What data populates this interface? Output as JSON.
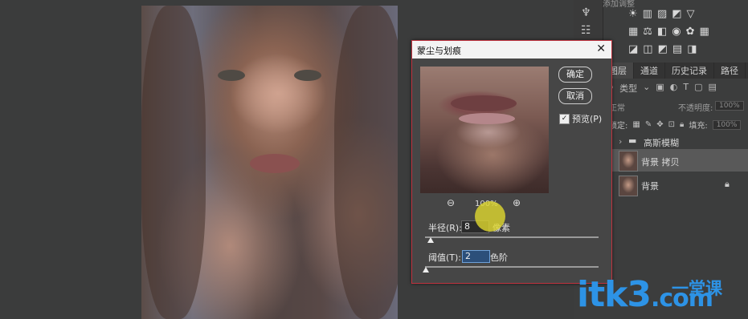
{
  "dialog": {
    "title": "蒙尘与划痕",
    "close_glyph": "✕",
    "ok_label": "确定",
    "cancel_label": "取消",
    "preview_checkbox_checked": true,
    "preview_label": "预览(P)",
    "zoom_level": "100%",
    "radius_label": "半径(R):",
    "radius_value": "8",
    "radius_unit": "像素",
    "threshold_label": "阈值(T):",
    "threshold_value": "2",
    "threshold_unit": "色阶"
  },
  "panel": {
    "tabs": [
      {
        "label": "图层"
      },
      {
        "label": "通道"
      },
      {
        "label": "历史记录"
      },
      {
        "label": "路径"
      }
    ],
    "filter_type": "类型",
    "blend_mode": "正常",
    "opacity_label": "不透明度:",
    "opacity_value": "100%",
    "lock_label": "锁定:",
    "fill_label": "填充:",
    "fill_value": "100%",
    "layers": [
      {
        "name": "高斯模糊",
        "kind": "group"
      },
      {
        "name": "背景 拷贝",
        "kind": "layer",
        "selected": true
      },
      {
        "name": "背景",
        "kind": "layer",
        "locked": true
      }
    ]
  },
  "adjustments_header": "添加调整",
  "watermark": {
    "text": "itk3",
    "domain": ".com",
    "cn": "一堂课"
  },
  "colors": {
    "dialog_border": "#c0333f",
    "watermark": "#2d93e6",
    "cursor_halo": "#ddd630"
  }
}
